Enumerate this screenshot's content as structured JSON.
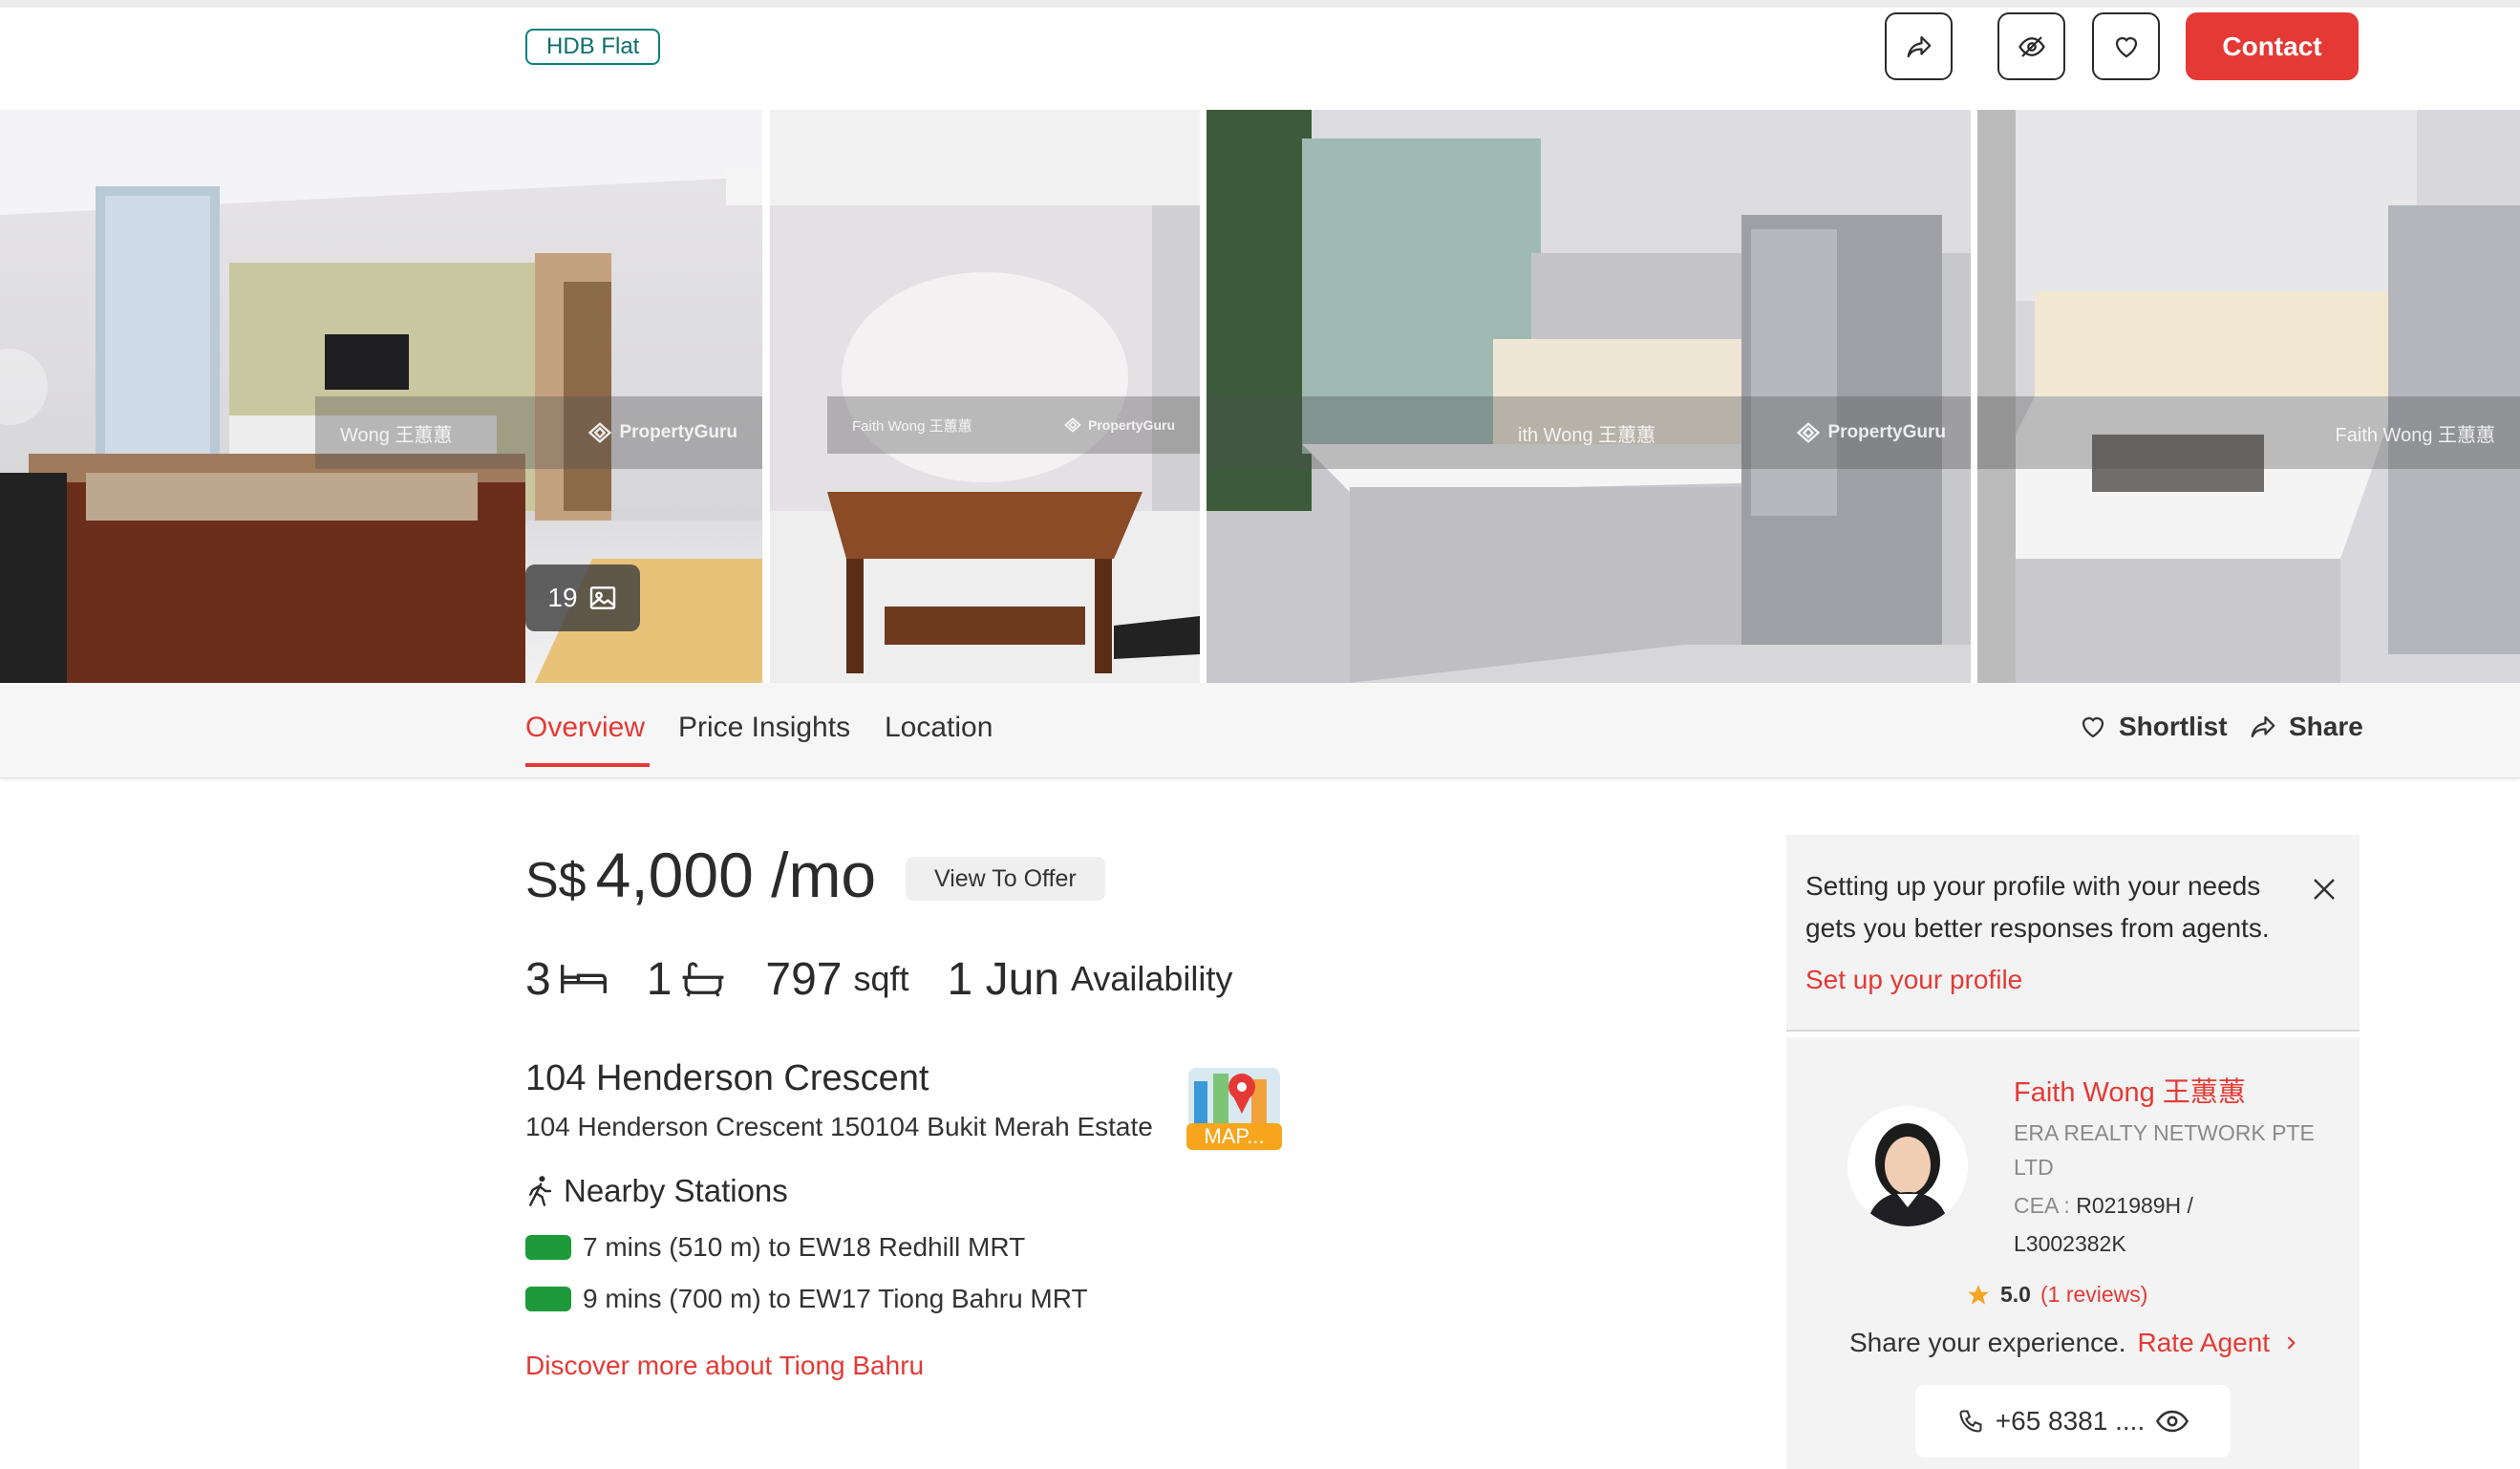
{
  "header": {
    "property_type": "HDB Flat",
    "contact_label": "Contact",
    "icons": [
      "share-icon",
      "hide-icon",
      "heart-icon"
    ]
  },
  "gallery": {
    "photo_count": "19",
    "watermark_name": "Faith Wong 王蕙蕙",
    "watermark_brand": "PropertyGuru",
    "watermark_name_partial_1": "Wong 王蕙蕙",
    "watermark_name_partial_3": "ith Wong 王蕙蕙"
  },
  "tabs": {
    "items": [
      "Overview",
      "Price Insights",
      "Location"
    ],
    "active": "Overview",
    "shortlist_label": "Shortlist",
    "share_label": "Share"
  },
  "listing": {
    "currency": "S$",
    "price": "4,000 /mo",
    "offer_label": "View To Offer",
    "bedrooms": "3",
    "bathrooms": "1",
    "area": "797",
    "area_unit": "sqft",
    "availability_date": "1 Jun",
    "availability_label": "Availability",
    "address_title": "104 Henderson Crescent",
    "address_full": "104 Henderson Crescent 150104 Bukit Merah Estate",
    "map_label": "MAP...",
    "nearby_title": "Nearby Stations",
    "stations": [
      "7 mins (510 m) to EW18 Redhill MRT",
      "9 mins (700 m) to EW17 Tiong Bahru MRT"
    ],
    "discover_link": "Discover more about Tiong Bahru"
  },
  "profile_notice": {
    "text": "Setting up your profile with your needs gets you better responses from agents.",
    "link": "Set up your profile"
  },
  "agent": {
    "name": "Faith Wong 王蕙蕙",
    "agency": "ERA REALTY NETWORK PTE LTD",
    "cea_label": "CEA :",
    "cea_value": "R021989H / L3002382K",
    "rating": "5.0",
    "reviews": "(1 reviews)",
    "share_text": "Share your experience.",
    "rate_link": "Rate Agent",
    "phone": "+65 8381 ...."
  },
  "colors": {
    "accent": "#e53935",
    "station_bar": "#1e9a3a",
    "tag_border": "#0d7f7f"
  }
}
